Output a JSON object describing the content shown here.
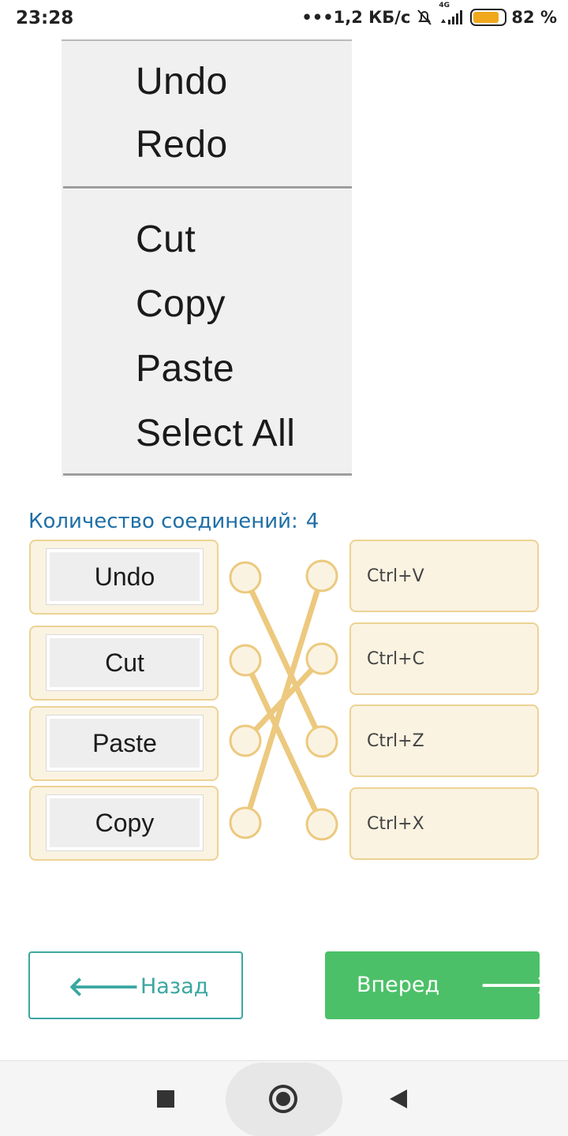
{
  "status_bar": {
    "time": "23:28",
    "network_speed": "•••1,2 КБ/с",
    "network_type": "4G",
    "battery_percent": "82 %",
    "battery_level": 0.82
  },
  "menu_image": {
    "items": [
      "Undo",
      "Redo",
      "Cut",
      "Copy",
      "Paste",
      "Select All"
    ]
  },
  "question": {
    "connections_label": "Количество соединений:",
    "connections_count": "4"
  },
  "left_items": [
    "Undo",
    "Cut",
    "Paste",
    "Copy"
  ],
  "right_items": [
    "Ctrl+V",
    "Ctrl+C",
    "Ctrl+Z",
    "Ctrl+X"
  ],
  "connections": [
    [
      0,
      2
    ],
    [
      1,
      3
    ],
    [
      2,
      1
    ],
    [
      3,
      0
    ]
  ],
  "nav": {
    "back_label": "Назад",
    "next_label": "Вперед"
  },
  "colors": {
    "accent_teal": "#3aa7a0",
    "next_green": "#4cc068",
    "card_bg": "#fbf3e2",
    "connector": "#ecc97e",
    "question_text": "#1f6fa6"
  }
}
